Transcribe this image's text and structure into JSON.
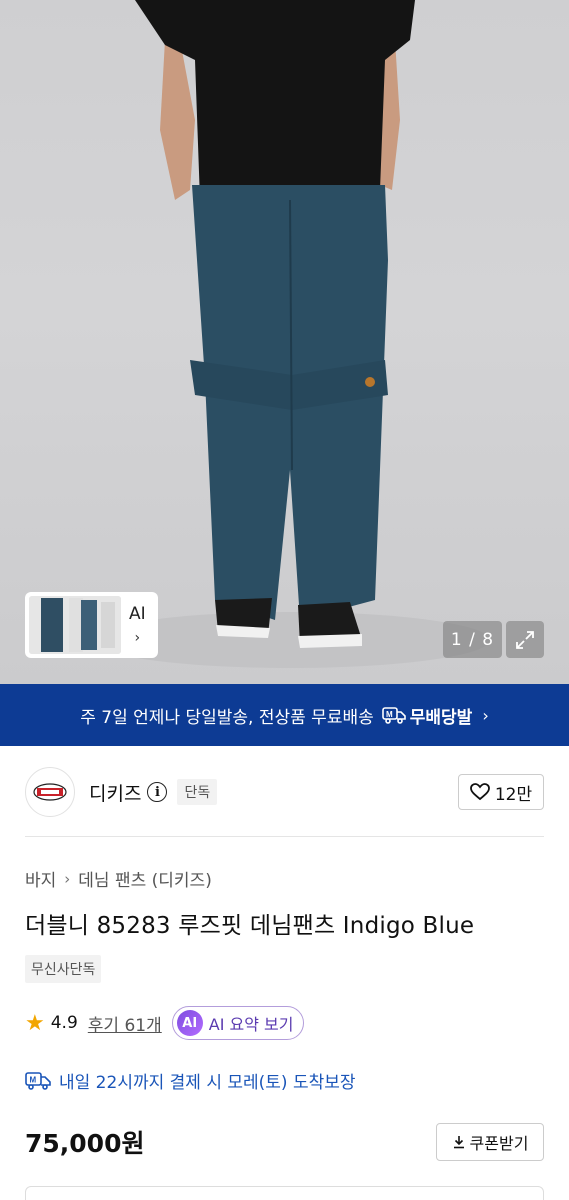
{
  "gallery": {
    "thumb_label": "AI",
    "thumb_chevron": "›",
    "counter": "1 / 8",
    "expand_icon": "expand-icon"
  },
  "banner": {
    "text": "주 7일 언제나 당일발송, 전상품 무료배송",
    "badge_label": "무배당발",
    "badge_icon": "delivery-truck-icon",
    "chevron": "›",
    "color": "#0d3b94"
  },
  "brand": {
    "logo_icon": "dickies-logo",
    "name": "디키즈",
    "info_icon": "info-icon",
    "tag": "단독",
    "like_icon": "heart-icon",
    "like_count": "12만"
  },
  "product": {
    "breadcrumb": [
      "바지",
      "데님 팬츠 (디키즈)"
    ],
    "breadcrumb_separator": "›",
    "title": "더블니 85283 루즈핏 데님팬츠 Indigo Blue",
    "exclusive_label": "무신사단독",
    "rating_icon": "star-icon",
    "rating": "4.9",
    "review_text": "후기 61개",
    "ai_badge": "AI",
    "ai_summary_label": "AI 요약 보기",
    "delivery_icon": "delivery-truck-icon",
    "delivery_text": "내일 22시까지 결제 시 모레(토) 도착보장",
    "price": "75,000원",
    "coupon_icon": "download-icon",
    "coupon_label": "쿠폰받기"
  },
  "colors": {
    "star": "#f2a600",
    "delivery_text": "#1a55b8",
    "ai_purple": "#5b3bb0"
  }
}
